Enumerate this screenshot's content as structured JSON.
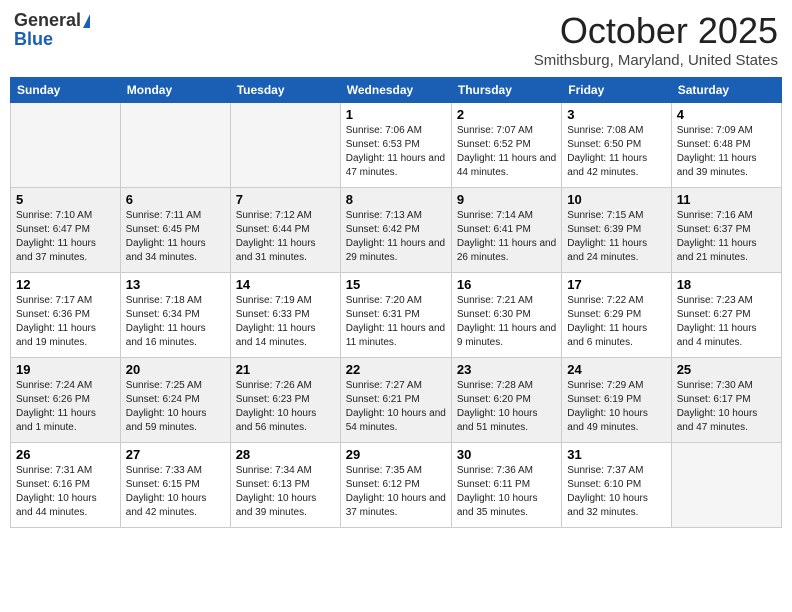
{
  "header": {
    "logo_general": "General",
    "logo_blue": "Blue",
    "month": "October 2025",
    "location": "Smithsburg, Maryland, United States"
  },
  "weekdays": [
    "Sunday",
    "Monday",
    "Tuesday",
    "Wednesday",
    "Thursday",
    "Friday",
    "Saturday"
  ],
  "weeks": [
    [
      {
        "day": "",
        "sunrise": "",
        "sunset": "",
        "daylight": ""
      },
      {
        "day": "",
        "sunrise": "",
        "sunset": "",
        "daylight": ""
      },
      {
        "day": "",
        "sunrise": "",
        "sunset": "",
        "daylight": ""
      },
      {
        "day": "1",
        "sunrise": "Sunrise: 7:06 AM",
        "sunset": "Sunset: 6:53 PM",
        "daylight": "Daylight: 11 hours and 47 minutes."
      },
      {
        "day": "2",
        "sunrise": "Sunrise: 7:07 AM",
        "sunset": "Sunset: 6:52 PM",
        "daylight": "Daylight: 11 hours and 44 minutes."
      },
      {
        "day": "3",
        "sunrise": "Sunrise: 7:08 AM",
        "sunset": "Sunset: 6:50 PM",
        "daylight": "Daylight: 11 hours and 42 minutes."
      },
      {
        "day": "4",
        "sunrise": "Sunrise: 7:09 AM",
        "sunset": "Sunset: 6:48 PM",
        "daylight": "Daylight: 11 hours and 39 minutes."
      }
    ],
    [
      {
        "day": "5",
        "sunrise": "Sunrise: 7:10 AM",
        "sunset": "Sunset: 6:47 PM",
        "daylight": "Daylight: 11 hours and 37 minutes."
      },
      {
        "day": "6",
        "sunrise": "Sunrise: 7:11 AM",
        "sunset": "Sunset: 6:45 PM",
        "daylight": "Daylight: 11 hours and 34 minutes."
      },
      {
        "day": "7",
        "sunrise": "Sunrise: 7:12 AM",
        "sunset": "Sunset: 6:44 PM",
        "daylight": "Daylight: 11 hours and 31 minutes."
      },
      {
        "day": "8",
        "sunrise": "Sunrise: 7:13 AM",
        "sunset": "Sunset: 6:42 PM",
        "daylight": "Daylight: 11 hours and 29 minutes."
      },
      {
        "day": "9",
        "sunrise": "Sunrise: 7:14 AM",
        "sunset": "Sunset: 6:41 PM",
        "daylight": "Daylight: 11 hours and 26 minutes."
      },
      {
        "day": "10",
        "sunrise": "Sunrise: 7:15 AM",
        "sunset": "Sunset: 6:39 PM",
        "daylight": "Daylight: 11 hours and 24 minutes."
      },
      {
        "day": "11",
        "sunrise": "Sunrise: 7:16 AM",
        "sunset": "Sunset: 6:37 PM",
        "daylight": "Daylight: 11 hours and 21 minutes."
      }
    ],
    [
      {
        "day": "12",
        "sunrise": "Sunrise: 7:17 AM",
        "sunset": "Sunset: 6:36 PM",
        "daylight": "Daylight: 11 hours and 19 minutes."
      },
      {
        "day": "13",
        "sunrise": "Sunrise: 7:18 AM",
        "sunset": "Sunset: 6:34 PM",
        "daylight": "Daylight: 11 hours and 16 minutes."
      },
      {
        "day": "14",
        "sunrise": "Sunrise: 7:19 AM",
        "sunset": "Sunset: 6:33 PM",
        "daylight": "Daylight: 11 hours and 14 minutes."
      },
      {
        "day": "15",
        "sunrise": "Sunrise: 7:20 AM",
        "sunset": "Sunset: 6:31 PM",
        "daylight": "Daylight: 11 hours and 11 minutes."
      },
      {
        "day": "16",
        "sunrise": "Sunrise: 7:21 AM",
        "sunset": "Sunset: 6:30 PM",
        "daylight": "Daylight: 11 hours and 9 minutes."
      },
      {
        "day": "17",
        "sunrise": "Sunrise: 7:22 AM",
        "sunset": "Sunset: 6:29 PM",
        "daylight": "Daylight: 11 hours and 6 minutes."
      },
      {
        "day": "18",
        "sunrise": "Sunrise: 7:23 AM",
        "sunset": "Sunset: 6:27 PM",
        "daylight": "Daylight: 11 hours and 4 minutes."
      }
    ],
    [
      {
        "day": "19",
        "sunrise": "Sunrise: 7:24 AM",
        "sunset": "Sunset: 6:26 PM",
        "daylight": "Daylight: 11 hours and 1 minute."
      },
      {
        "day": "20",
        "sunrise": "Sunrise: 7:25 AM",
        "sunset": "Sunset: 6:24 PM",
        "daylight": "Daylight: 10 hours and 59 minutes."
      },
      {
        "day": "21",
        "sunrise": "Sunrise: 7:26 AM",
        "sunset": "Sunset: 6:23 PM",
        "daylight": "Daylight: 10 hours and 56 minutes."
      },
      {
        "day": "22",
        "sunrise": "Sunrise: 7:27 AM",
        "sunset": "Sunset: 6:21 PM",
        "daylight": "Daylight: 10 hours and 54 minutes."
      },
      {
        "day": "23",
        "sunrise": "Sunrise: 7:28 AM",
        "sunset": "Sunset: 6:20 PM",
        "daylight": "Daylight: 10 hours and 51 minutes."
      },
      {
        "day": "24",
        "sunrise": "Sunrise: 7:29 AM",
        "sunset": "Sunset: 6:19 PM",
        "daylight": "Daylight: 10 hours and 49 minutes."
      },
      {
        "day": "25",
        "sunrise": "Sunrise: 7:30 AM",
        "sunset": "Sunset: 6:17 PM",
        "daylight": "Daylight: 10 hours and 47 minutes."
      }
    ],
    [
      {
        "day": "26",
        "sunrise": "Sunrise: 7:31 AM",
        "sunset": "Sunset: 6:16 PM",
        "daylight": "Daylight: 10 hours and 44 minutes."
      },
      {
        "day": "27",
        "sunrise": "Sunrise: 7:33 AM",
        "sunset": "Sunset: 6:15 PM",
        "daylight": "Daylight: 10 hours and 42 minutes."
      },
      {
        "day": "28",
        "sunrise": "Sunrise: 7:34 AM",
        "sunset": "Sunset: 6:13 PM",
        "daylight": "Daylight: 10 hours and 39 minutes."
      },
      {
        "day": "29",
        "sunrise": "Sunrise: 7:35 AM",
        "sunset": "Sunset: 6:12 PM",
        "daylight": "Daylight: 10 hours and 37 minutes."
      },
      {
        "day": "30",
        "sunrise": "Sunrise: 7:36 AM",
        "sunset": "Sunset: 6:11 PM",
        "daylight": "Daylight: 10 hours and 35 minutes."
      },
      {
        "day": "31",
        "sunrise": "Sunrise: 7:37 AM",
        "sunset": "Sunset: 6:10 PM",
        "daylight": "Daylight: 10 hours and 32 minutes."
      },
      {
        "day": "",
        "sunrise": "",
        "sunset": "",
        "daylight": ""
      }
    ]
  ]
}
